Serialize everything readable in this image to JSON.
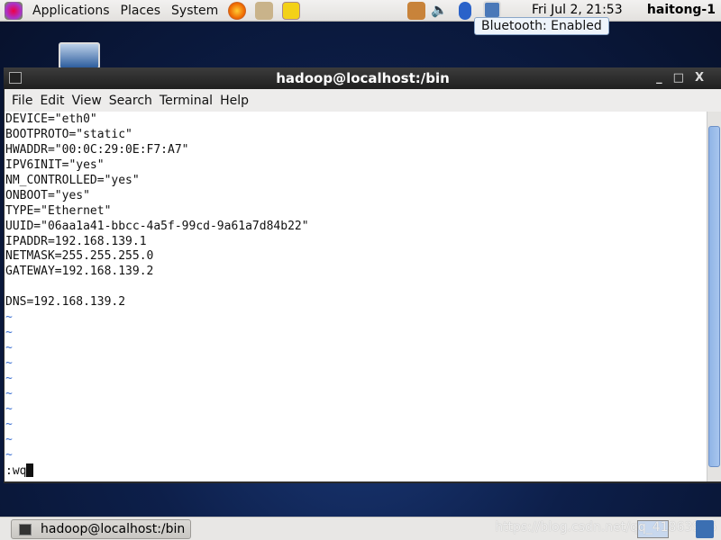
{
  "top_panel": {
    "menus": [
      "Applications",
      "Places",
      "System"
    ],
    "clock": "Fri Jul  2, 21:53",
    "user": "haitong-1",
    "tooltip": "Bluetooth: Enabled"
  },
  "window": {
    "title": "hadoop@localhost:/bin",
    "menu": [
      "File",
      "Edit",
      "View",
      "Search",
      "Terminal",
      "Help"
    ]
  },
  "terminal": {
    "lines": [
      "DEVICE=\"eth0\"",
      "BOOTPROTO=\"static\"",
      "HWADDR=\"00:0C:29:0E:F7:A7\"",
      "IPV6INIT=\"yes\"",
      "NM_CONTROLLED=\"yes\"",
      "ONBOOT=\"yes\"",
      "TYPE=\"Ethernet\"",
      "UUID=\"06aa1a41-bbcc-4a5f-99cd-9a61a7d84b22\"",
      "IPADDR=192.168.139.1",
      "NETMASK=255.255.255.0",
      "GATEWAY=192.168.139.2",
      "",
      "DNS=192.168.139.2"
    ],
    "tilde": "~",
    "command": ":wq"
  },
  "bottom_panel": {
    "task": "hadoop@localhost:/bin",
    "watermark": "https://blog.csdn.net/qq_41863966"
  }
}
